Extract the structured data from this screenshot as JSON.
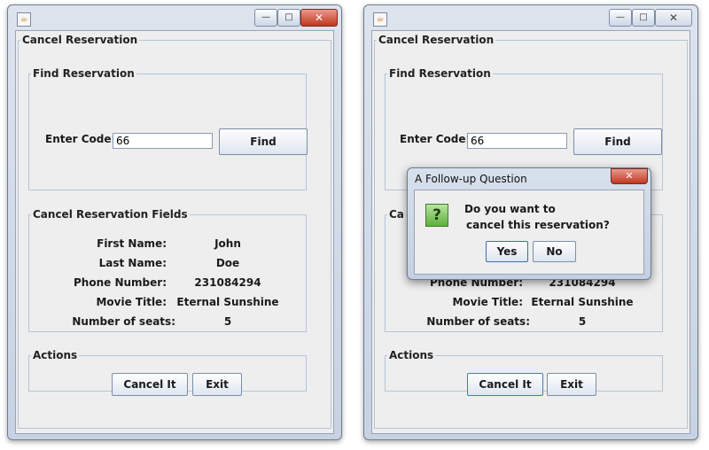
{
  "left_window": {
    "outer_title": "Cancel Reservation",
    "find": {
      "legend": "Find Reservation",
      "code_label": "Enter Code:",
      "code_value": "66",
      "find_button": "Find"
    },
    "fields": {
      "legend": "Cancel Reservation Fields",
      "rows": [
        {
          "label": "First Name:",
          "value": "John"
        },
        {
          "label": "Last Name:",
          "value": "Doe"
        },
        {
          "label": "Phone Number:",
          "value": "231084294"
        },
        {
          "label": "Movie Title:",
          "value": "Eternal Sunshine"
        },
        {
          "label": "Number of seats:",
          "value": "5"
        }
      ]
    },
    "actions": {
      "legend": "Actions",
      "cancel_button": "Cancel It",
      "exit_button": "Exit"
    }
  },
  "right_window": {
    "outer_title": "Cancel Reservation",
    "find": {
      "legend": "Find Reservation",
      "code_label": "Enter Code:",
      "code_value": "66",
      "find_button": "Find"
    },
    "fields": {
      "legend_partial": "Ca",
      "rows": [
        {
          "label": "Phone Number:",
          "value": "231084294"
        },
        {
          "label": "Movie Title:",
          "value": "Eternal Sunshine"
        },
        {
          "label": "Number of seats:",
          "value": "5"
        }
      ]
    },
    "actions": {
      "legend": "Actions",
      "cancel_button": "Cancel It",
      "exit_button": "Exit"
    }
  },
  "dialog": {
    "title": "A Follow-up Question",
    "icon": "question-icon",
    "message_line1": "Do you want to",
    "message_line2": "cancel this reservation?",
    "yes_button": "Yes",
    "no_button": "No"
  },
  "icons": {
    "minimize": "—",
    "maximize": "□",
    "close": "✕",
    "question": "?",
    "app": "☕"
  },
  "colors": {
    "window_bg": "#eeeeee",
    "close_red": "#c2361f",
    "question_green": "#5fae3c"
  }
}
